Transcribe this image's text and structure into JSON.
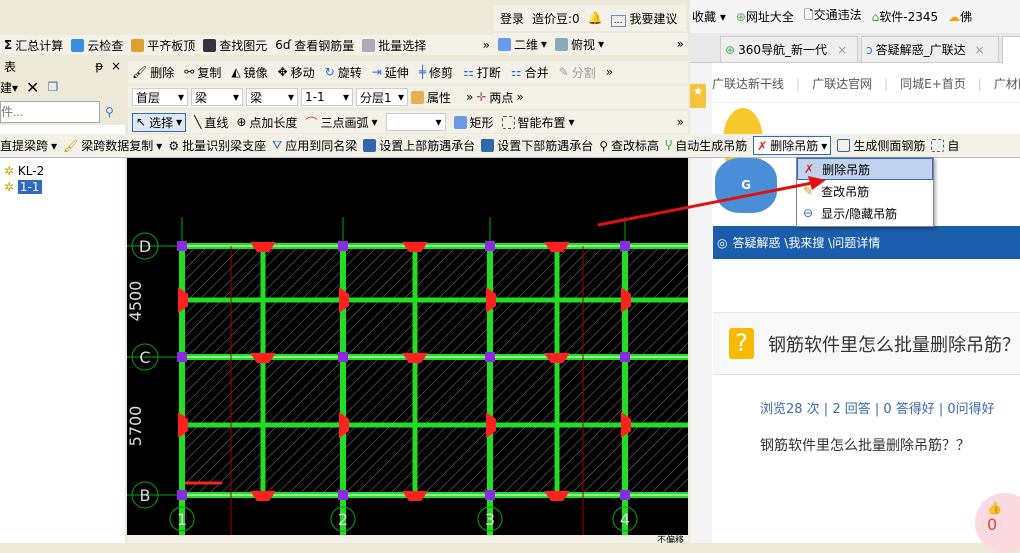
{
  "topbar": {
    "login": "登录",
    "beans": "造价豆:0",
    "suggest": "我要建议"
  },
  "main_toolbar": {
    "items": [
      "汇总计算",
      "云检查",
      "平齐板顶",
      "查找图元",
      "查看钢筋量",
      "批量选择"
    ],
    "more": "»",
    "view2d": "二维",
    "view_top": "俯视"
  },
  "left_panel": {
    "title": "表",
    "new": "建",
    "search_placeholder": "件...",
    "tree": [
      {
        "label": "KL-2",
        "selected": false
      },
      {
        "label": "1-1",
        "selected": true
      }
    ]
  },
  "edit_toolbar": {
    "items": [
      "删除",
      "复制",
      "镜像",
      "移动",
      "旋转",
      "延伸",
      "修剪",
      "打断",
      "合并",
      "分割"
    ],
    "more": "»"
  },
  "selector_bar": {
    "floor": "首层",
    "type1": "梁",
    "type2": "梁",
    "name": "1-1",
    "layer": "分层1",
    "props": "属性",
    "two_points": "两点",
    "more": "»"
  },
  "draw_toolbar": {
    "items": [
      "选择",
      "直线",
      "点加长度",
      "三点画弧",
      "矩形",
      "智能布置"
    ],
    "more": "»"
  },
  "beam_toolbar": {
    "items": [
      "直提梁跨",
      "梁跨数据复制",
      "批量识别梁支座",
      "应用到同名梁",
      "设置上部筋遇承台",
      "设置下部筋遇承台",
      "查改标高",
      "自动生成吊筋",
      "删除吊筋",
      "生成侧面钢筋",
      "自"
    ]
  },
  "dropdown_menu": {
    "items": [
      "删除吊筋",
      "查改吊筋",
      "显示/隐藏吊筋"
    ],
    "highlighted": 0
  },
  "canvas": {
    "axes_rows": [
      "D",
      "C",
      "B"
    ],
    "axes_cols": [
      "1",
      "2",
      "3",
      "4"
    ],
    "dims": [
      "4500",
      "5700"
    ],
    "colors": {
      "beam": "#22DD22",
      "bg": "#000000",
      "support": "#FF2020"
    }
  },
  "bottom_bar": {
    "items": [
      "不偏移"
    ]
  },
  "browser": {
    "bookmarks": [
      "收藏",
      "网址大全",
      "交通违法",
      "软件-2345",
      "佛"
    ],
    "tabs": [
      {
        "label": "360导航_新一代"
      },
      {
        "label": "答疑解惑_广联达"
      }
    ],
    "links": [
      "广联达新干线",
      "广联达官网",
      "同城E+首页",
      "广材网"
    ],
    "breadcrumb": "答疑解惑 \\我来搜 \\问题详情",
    "question_title": "钢筋软件里怎么批量删除吊筋？",
    "stats": "浏览28 次 | 2 回答 | 0 答得好 | 0问得好",
    "question_body": "钢筋软件里怎么批量删除吊筋？？",
    "likes": "0",
    "accent": "#1A5EAB"
  }
}
